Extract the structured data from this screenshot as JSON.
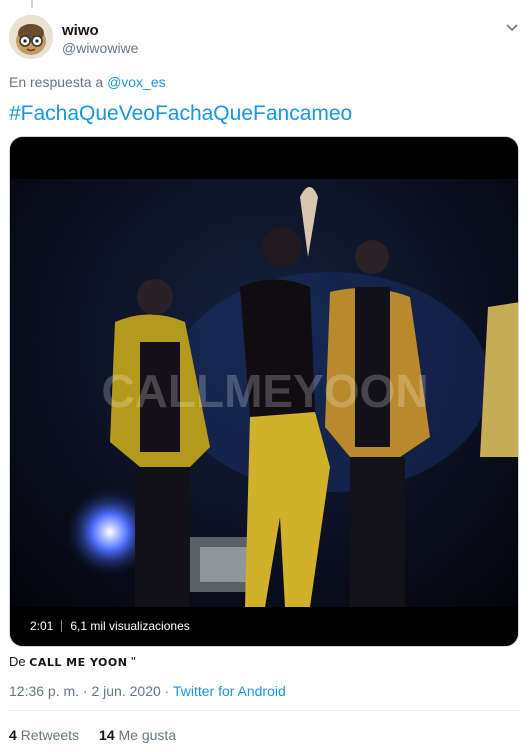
{
  "author": {
    "name": "wiwo",
    "handle": "@wiwowiwe"
  },
  "reply": {
    "prefix": "En respuesta a",
    "to": "@vox_es"
  },
  "tweet": {
    "hashtag": "#FachaQueVeoFachaQueFancameo"
  },
  "media": {
    "duration": "2:01",
    "views": "6,1 mil visualizaciones",
    "watermark": "CALLMEYOON"
  },
  "source_line": {
    "prefix": "De",
    "name": "CALL ME YOON",
    "suffix": "\""
  },
  "meta": {
    "time": "12:36 p. m. · 2 jun. 2020 · ",
    "client": "Twitter for Android"
  },
  "stats": {
    "retweets_count": "4",
    "retweets_label": "Retweets",
    "likes_count": "14",
    "likes_label": "Me gusta"
  },
  "icons": {
    "more": "chevron-down-icon",
    "play_overlay": "none"
  }
}
